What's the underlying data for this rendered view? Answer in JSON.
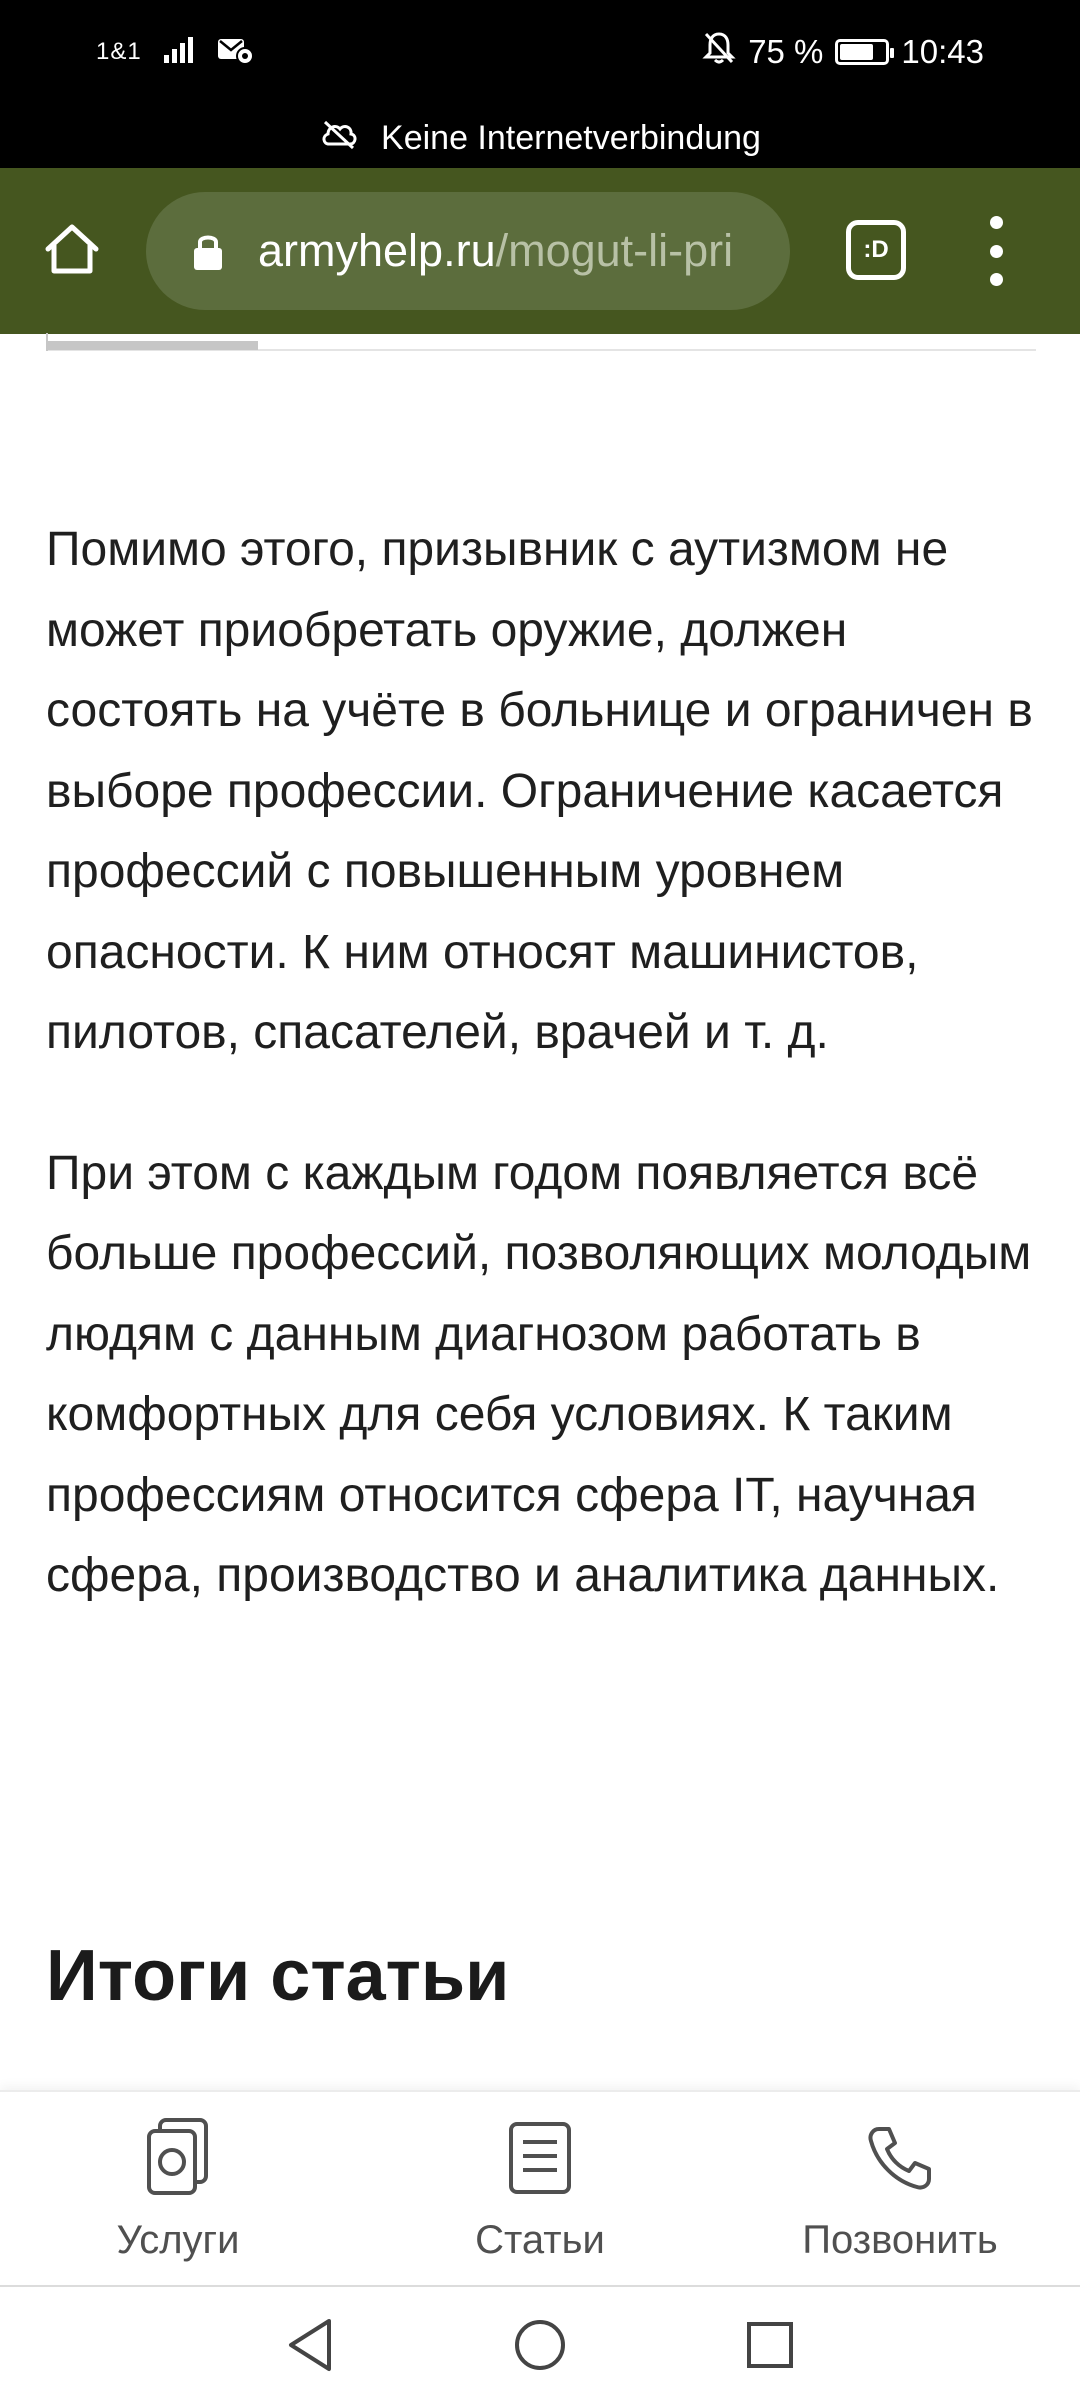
{
  "status_bar": {
    "carrier": "1&1",
    "battery_percent": "75 %",
    "battery_level": 0.75,
    "time": "10:43",
    "offline_notice": "Keine Internetverbindung",
    "icons": [
      "signal-icon",
      "wifi-calling-icon",
      "mute-icon",
      "battery-icon",
      "cloud-off-icon"
    ]
  },
  "browser": {
    "url_host": "armyhelp.ru",
    "url_path": "/mogut-li-pri",
    "tab_label": ":D",
    "colors": {
      "toolbar": "#45561f",
      "urlbar": "#5c6d3d"
    }
  },
  "article": {
    "paragraph_1": "Помимо этого, призывник с аутизмом не может приобретать оружие, должен состоять на учёте в больнице и ограничен в выборе профессии. Ограничение касается профессий с повышенным уровнем опасности. К ним относят машинистов, пилотов, спасателей, врачей и т. д.",
    "paragraph_2": "При этом с каждым годом появляется всё больше профессий, позволяющих молодым людям с данным диагнозом работать в комфортных для себя условиях. К таким профессиям относится сфера IT, научная сфера, производство и аналитика данных.",
    "heading": "Итоги статьи"
  },
  "bottom_nav": {
    "items": [
      {
        "label": "Услуги",
        "icon": "services-icon"
      },
      {
        "label": "Статьи",
        "icon": "articles-icon"
      },
      {
        "label": "Позвонить",
        "icon": "phone-icon"
      }
    ]
  },
  "system_nav": [
    "back-icon",
    "home-circle-icon",
    "recents-icon"
  ]
}
